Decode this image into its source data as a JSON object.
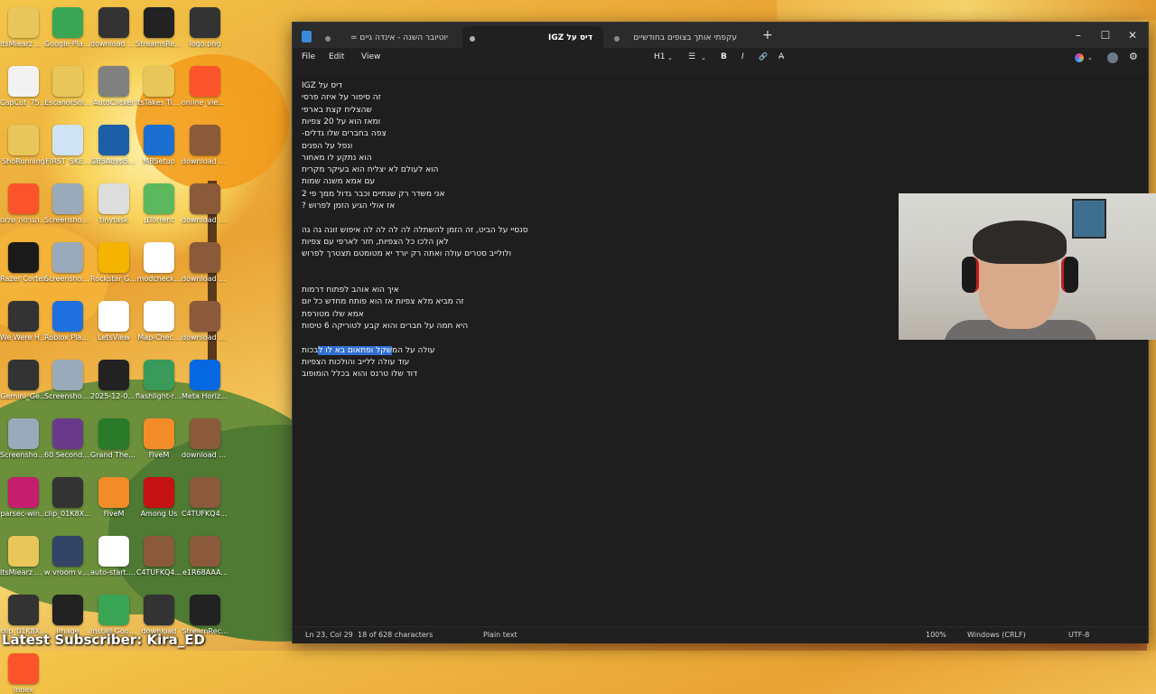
{
  "desktop": {
    "banner": "Latest Subscriber: Kira_ED",
    "icons": [
      {
        "label": "ItsMiearz Gobblemo...",
        "icon": "folder-icon",
        "color": "#e8c65a"
      },
      {
        "label": "Google Play Games beta",
        "icon": "google-play-games-icon",
        "color": "#3aa655"
      },
      {
        "label": "download (1) (1)",
        "icon": "image-file-icon",
        "color": "#333333"
      },
      {
        "label": "StreamsRec...",
        "icon": "app-icon",
        "color": "#222222"
      },
      {
        "label": "logo.png",
        "icon": "image-file-icon",
        "color": "#333333"
      },
      {
        "label": "CapCut_755...",
        "icon": "capcut-icon",
        "color": "#f2f2f2"
      },
      {
        "label": "EscanorSol...",
        "icon": "folder-icon",
        "color": "#e8c65a"
      },
      {
        "label": "AutoClicker",
        "icon": "mouse-icon",
        "color": "#808080"
      },
      {
        "label": "ItsTakes Tiw...",
        "icon": "folder-icon",
        "color": "#e8c65a"
      },
      {
        "label": "online_view...",
        "icon": "brave-icon",
        "color": "#fb542b"
      },
      {
        "label": "ShoRunning",
        "icon": "folder-icon",
        "color": "#e8c65a"
      },
      {
        "label": "FIRST_SKE...",
        "icon": "image-file-icon",
        "color": "#cfe3f5"
      },
      {
        "label": "GB5Adyp5z...",
        "icon": "image-file-icon",
        "color": "#1c5fa8"
      },
      {
        "label": "MBSetup",
        "icon": "malwarebytes-icon",
        "color": "#1a6fd1"
      },
      {
        "label": "download (3)",
        "icon": "image-file-icon",
        "color": "#8a5a3a"
      },
      {
        "label": "עמ הגרסה שלום",
        "icon": "brave-icon",
        "color": "#fb542b"
      },
      {
        "label": "Screenshot 2025-10-...",
        "icon": "image-file-icon",
        "color": "#9ab"
      },
      {
        "label": "tinytask",
        "icon": "gear-icon",
        "color": "#dddddd"
      },
      {
        "label": "μTorrent",
        "icon": "utorrent-icon",
        "color": "#5cb85c"
      },
      {
        "label": "download (3) (1)",
        "icon": "image-file-icon",
        "color": "#8a5a3a"
      },
      {
        "label": "Razer Cortex",
        "icon": "razer-icon",
        "color": "#1a1a1a"
      },
      {
        "label": "Screenshot 2025-10-...",
        "icon": "image-file-icon",
        "color": "#9ab"
      },
      {
        "label": "Rockstar Games...",
        "icon": "rockstar-icon",
        "color": "#f5b400"
      },
      {
        "label": "modcheck...",
        "icon": "java-icon",
        "color": "#ffffff"
      },
      {
        "label": "download (4)",
        "icon": "image-file-icon",
        "color": "#8a5a3a"
      },
      {
        "label": "We Were Here Tog...",
        "icon": "game-icon",
        "color": "#333333"
      },
      {
        "label": "Roblox Player",
        "icon": "roblox-icon",
        "color": "#1e6fe0"
      },
      {
        "label": "LetsView",
        "icon": "letsview-icon",
        "color": "#ffffff"
      },
      {
        "label": "Map-Chec...",
        "icon": "java-icon",
        "color": "#ffffff"
      },
      {
        "label": "download (4) (1)",
        "icon": "image-file-icon",
        "color": "#8a5a3a"
      },
      {
        "label": "Gemini_Ge...",
        "icon": "image-file-icon",
        "color": "#333333"
      },
      {
        "label": "Screenshot 2024-12-...",
        "icon": "image-file-icon",
        "color": "#9ab"
      },
      {
        "label": "2025-12-08 17-25-42...",
        "icon": "video-file-icon",
        "color": "#222222"
      },
      {
        "label": "flashlight-re...",
        "icon": "app-icon",
        "color": "#3a9a5a"
      },
      {
        "label": "Meta Horizon Link",
        "icon": "meta-icon",
        "color": "#0668e1"
      },
      {
        "label": "Screenshot 2025-12-...",
        "icon": "image-file-icon",
        "color": "#9ab"
      },
      {
        "label": "60 Seconds! Reatomized",
        "icon": "game-icon",
        "color": "#6a3a8a"
      },
      {
        "label": "Grand Theft Auto V",
        "icon": "gta-icon",
        "color": "#2a7a2a"
      },
      {
        "label": "FiveM",
        "icon": "fivem-icon",
        "color": "#f28c28"
      },
      {
        "label": "download (2)",
        "icon": "image-file-icon",
        "color": "#8a5a3a"
      },
      {
        "label": "parsec-win...",
        "icon": "parsec-icon",
        "color": "#c61e6f"
      },
      {
        "label": "clip_01K8X...",
        "icon": "video-file-icon",
        "color": "#333333"
      },
      {
        "label": "FiveM",
        "icon": "fivem-icon",
        "color": "#f28c28"
      },
      {
        "label": "Among Us",
        "icon": "among-us-icon",
        "color": "#c51111"
      },
      {
        "label": "C4TUFKQ4... (1)",
        "icon": "image-file-icon",
        "color": "#8a5a3a"
      },
      {
        "label": "ItsMiearz Gobblemo...",
        "icon": "folder-icon",
        "color": "#e8c65a"
      },
      {
        "label": "w vroom vroom",
        "icon": "video-file-icon",
        "color": "#334466"
      },
      {
        "label": "auto-start.txt",
        "icon": "text-file-icon",
        "color": "#ffffff"
      },
      {
        "label": "C4TUFKQ4...",
        "icon": "image-file-icon",
        "color": "#8a5a3a"
      },
      {
        "label": "e1R68AAA...",
        "icon": "image-file-icon",
        "color": "#8a5a3a"
      },
      {
        "label": "clip_01K8X...",
        "icon": "video-file-icon",
        "color": "#333333"
      },
      {
        "label": "image",
        "icon": "image-file-icon",
        "color": "#222222"
      },
      {
        "label": "Install Goo... Play Games",
        "icon": "google-play-games-icon",
        "color": "#3aa655"
      },
      {
        "label": "download",
        "icon": "image-file-icon",
        "color": "#333333"
      },
      {
        "label": "StreamRec...",
        "icon": "app-icon",
        "color": "#222222"
      },
      {
        "label": "index",
        "icon": "brave-icon",
        "color": "#fb542b"
      }
    ]
  },
  "notepad": {
    "tabs": [
      {
        "label": "יוטיובר השנה - אינדה גיים =",
        "active": false
      },
      {
        "label": "דיס על IGZ",
        "active": true
      },
      {
        "label": "עקפתי אותך בצופים בחודשיים",
        "active": false
      }
    ],
    "new_tab": "+",
    "window_controls": {
      "minimize": "–",
      "maximize": "☐",
      "close": "✕"
    },
    "menu": {
      "file": "File",
      "edit": "Edit",
      "view": "View"
    },
    "toolbar": {
      "heading": "H1",
      "list": "☰",
      "bold": "B",
      "italic": "I",
      "link": "🔗",
      "clear": "A̶"
    },
    "lines": [
      "דיס על IGZ",
      "זה סיפור על איזה פרסי",
      "שהצליח קצת בארפי",
      "ומאז הוא על 20 צפיות",
      "צפה בחברים שלו גדלים-",
      "ונפל על הפנים",
      "הוא נתקע לו מאחור",
      "הוא לעולם לא יצליח הוא בעיקר מקריח",
      "עם אמא משנה שמות",
      "אני משדר רק שנתיים וכבר גדול ממך פי 2",
      "אז אולי הגיע הזמן לפרוש ?",
      "",
      "סנסיי על הביט, זה הזמן להשתלה לה לה לה לה איפוש זונה גה גה",
      "לאן הלכו כל הצפיות, חזר לארפי עם צפיות",
      "ולולייב סטרים עולה ואתה רק יורד יא מטומטם תצטרך לפרוש",
      "",
      "",
      "איך הוא אוהב לפתוח דרמות",
      "זה מביא מלא צפיות אז הוא פותח מחדש כל יום",
      "אמא שלו מטורפת",
      "היא חמה על חברים והוא קבע לטוריקה 6 טיסות",
      "",
      "עולה על המשקל ופתאום בא לו לבכות",
      "עוד עולה ללייב והולכות הצפיות",
      "דוד שלו טרנס והוא בכלל הומופוב"
    ],
    "selection": {
      "line": 22,
      "before": "עולה על המ",
      "selected": "שקל ופתאום בא לו ל",
      "after": "בכות"
    },
    "status": {
      "position": "Ln 23, Col 29",
      "chars": "18 of 628 characters",
      "format": "Plain text",
      "zoom": "100%",
      "line_endings": "Windows (CRLF)",
      "encoding": "UTF-8"
    }
  }
}
